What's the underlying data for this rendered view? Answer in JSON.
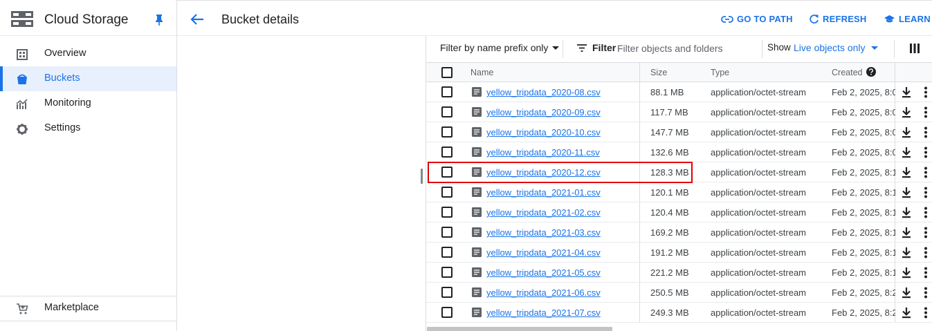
{
  "product": {
    "title": "Cloud Storage",
    "icon": "storage-icon",
    "pin_icon": "pin-icon"
  },
  "sidebar": {
    "items": [
      {
        "label": "Overview",
        "icon": "overview-icon",
        "active": false
      },
      {
        "label": "Buckets",
        "icon": "bucket-icon",
        "active": true
      },
      {
        "label": "Monitoring",
        "icon": "monitoring-icon",
        "active": false
      },
      {
        "label": "Settings",
        "icon": "gear-icon",
        "active": false
      }
    ],
    "footer": [
      {
        "label": "Marketplace",
        "icon": "cart-icon"
      }
    ]
  },
  "header": {
    "title": "Bucket details",
    "go_to_path": "GO TO PATH",
    "refresh": "REFRESH",
    "learn": "LEARN"
  },
  "filters": {
    "prefix_mode": "Filter by name prefix only",
    "filter_label": "Filter",
    "filter_placeholder": "Filter objects and folders",
    "show_label": "Show",
    "show_value": "Live objects only"
  },
  "table": {
    "columns": {
      "name": "Name",
      "size": "Size",
      "type": "Type",
      "created": "Created"
    },
    "rows": [
      {
        "name": "yellow_tripdata_2020-08.csv",
        "size": "88.1 MB",
        "type": "application/octet-stream",
        "created": "Feb 2, 2025, 8:0"
      },
      {
        "name": "yellow_tripdata_2020-09.csv",
        "size": "117.7 MB",
        "type": "application/octet-stream",
        "created": "Feb 2, 2025, 8:0"
      },
      {
        "name": "yellow_tripdata_2020-10.csv",
        "size": "147.7 MB",
        "type": "application/octet-stream",
        "created": "Feb 2, 2025, 8:0"
      },
      {
        "name": "yellow_tripdata_2020-11.csv",
        "size": "132.6 MB",
        "type": "application/octet-stream",
        "created": "Feb 2, 2025, 8:0"
      },
      {
        "name": "yellow_tripdata_2020-12.csv",
        "size": "128.3 MB",
        "type": "application/octet-stream",
        "created": "Feb 2, 2025, 8:1"
      },
      {
        "name": "yellow_tripdata_2021-01.csv",
        "size": "120.1 MB",
        "type": "application/octet-stream",
        "created": "Feb 2, 2025, 8:1"
      },
      {
        "name": "yellow_tripdata_2021-02.csv",
        "size": "120.4 MB",
        "type": "application/octet-stream",
        "created": "Feb 2, 2025, 8:1"
      },
      {
        "name": "yellow_tripdata_2021-03.csv",
        "size": "169.2 MB",
        "type": "application/octet-stream",
        "created": "Feb 2, 2025, 8:1"
      },
      {
        "name": "yellow_tripdata_2021-04.csv",
        "size": "191.2 MB",
        "type": "application/octet-stream",
        "created": "Feb 2, 2025, 8:1"
      },
      {
        "name": "yellow_tripdata_2021-05.csv",
        "size": "221.2 MB",
        "type": "application/octet-stream",
        "created": "Feb 2, 2025, 8:1"
      },
      {
        "name": "yellow_tripdata_2021-06.csv",
        "size": "250.5 MB",
        "type": "application/octet-stream",
        "created": "Feb 2, 2025, 8:2"
      },
      {
        "name": "yellow_tripdata_2021-07.csv",
        "size": "249.3 MB",
        "type": "application/octet-stream",
        "created": "Feb 2, 2025, 8:2"
      }
    ],
    "highlighted_row": "yellow_tripdata_2020-12.csv"
  },
  "colors": {
    "accent": "#1a73e8",
    "highlight": "#e00000"
  }
}
